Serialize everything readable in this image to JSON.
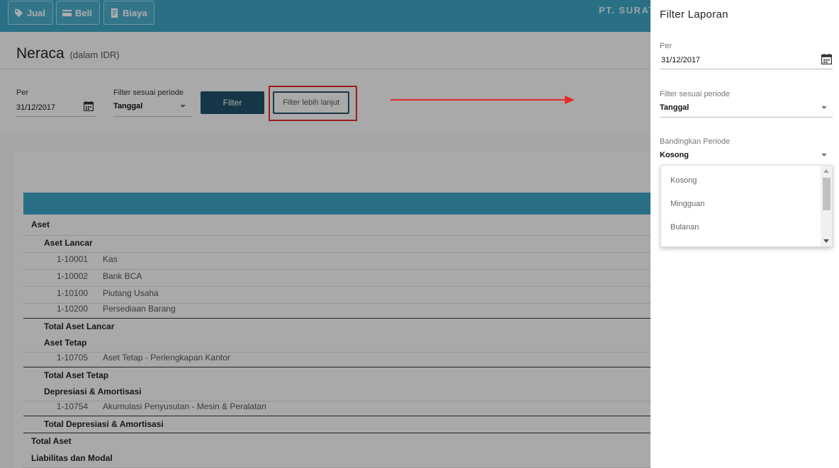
{
  "toolbar": {
    "buttons": [
      {
        "label": "Jual",
        "icon": "tag-icon"
      },
      {
        "label": "Beli",
        "icon": "credit-card-icon"
      },
      {
        "label": "Biaya",
        "icon": "receipt-icon"
      }
    ],
    "company": "PT. SURAT"
  },
  "header": {
    "title": "Neraca",
    "subtitle": "(dalam IDR)"
  },
  "filters": {
    "per_label": "Per",
    "per_value": "31/12/2017",
    "period_label": "Filter sesuai periode",
    "period_value": "Tanggal",
    "filter_button": "Filter",
    "more_button": "Filter lebih lanjut"
  },
  "report": {
    "rows": [
      {
        "type": "section",
        "label": "Aset"
      },
      {
        "type": "group",
        "label": "Aset Lancar"
      },
      {
        "type": "account",
        "code": "1-10001",
        "name": "Kas"
      },
      {
        "type": "account",
        "code": "1-10002",
        "name": "Bank BCA"
      },
      {
        "type": "account",
        "code": "1-10100",
        "name": "Piutang Usaha"
      },
      {
        "type": "account",
        "code": "1-10200",
        "name": "Persediaan Barang"
      },
      {
        "type": "total",
        "label": "Total Aset Lancar"
      },
      {
        "type": "group",
        "label": "Aset Tetap"
      },
      {
        "type": "account",
        "code": "1-10705",
        "name": "Aset Tetap - Perlengkapan Kantor"
      },
      {
        "type": "total",
        "label": "Total Aset Tetap"
      },
      {
        "type": "group",
        "label": "Depresiasi & Amortisasi"
      },
      {
        "type": "account",
        "code": "1-10754",
        "name": "Akumulasi Penyusutan - Mesin & Peralatan"
      },
      {
        "type": "total",
        "label": "Total Depresiasi & Amortisasi"
      },
      {
        "type": "section-total",
        "label": "Total Aset"
      },
      {
        "type": "section",
        "label": "Liabilitas dan Modal"
      }
    ]
  },
  "drawer": {
    "title": "Filter Laporan",
    "per_label": "Per",
    "per_value": "31/12/2017",
    "period_label": "Filter sesuai periode",
    "period_value": "Tanggal",
    "compare_label": "Bandingkan Periode",
    "compare_value": "Kosong",
    "compare_options": [
      "Kosong",
      "Mingguan",
      "Bulanan"
    ]
  },
  "colors": {
    "accent": "#3da6c7",
    "primary_button": "#1f5068",
    "highlight": "#e52b2b"
  }
}
